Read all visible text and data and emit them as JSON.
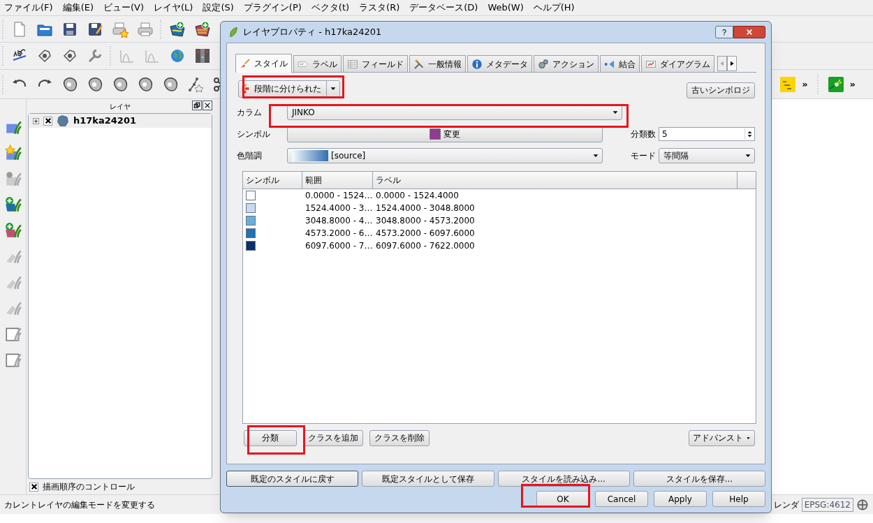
{
  "menu": [
    "ファイル(F)",
    "編集(E)",
    "ビュー(V)",
    "レイヤ(L)",
    "設定(S)",
    "プラグイン(P)",
    "ベクタ(t)",
    "ラスタ(R)",
    "データベース(D)",
    "Web(W)",
    "ヘルプ(H)"
  ],
  "layers_panel": {
    "title": "レイヤ",
    "layers": [
      {
        "name": "h17ka24201",
        "visible": true
      }
    ],
    "render_order": {
      "label": "描画順序のコントロール",
      "checked": true
    }
  },
  "toolbar_overflow": [
    "»",
    "»"
  ],
  "dialog": {
    "title": "レイヤプロパティ - h17ka24201",
    "tabs": [
      {
        "label": "スタイル",
        "selected": true
      },
      {
        "label": "ラベル",
        "selected": false
      },
      {
        "label": "フィールド",
        "selected": false
      },
      {
        "label": "一般情報",
        "selected": false
      },
      {
        "label": "メタデータ",
        "selected": false
      },
      {
        "label": "アクション",
        "selected": false
      },
      {
        "label": "結合",
        "selected": false
      },
      {
        "label": "ダイアグラム",
        "selected": false
      }
    ],
    "renderer": "段階に分けられた",
    "old_symbology_button": "古いシンボロジ",
    "column": {
      "label": "カラム",
      "value": "JINKO"
    },
    "symbol": {
      "label": "シンボル",
      "button": "変更"
    },
    "classes_count": {
      "label": "分類数",
      "value": "5"
    },
    "color_ramp": {
      "label": "色階調",
      "value": "[source]"
    },
    "mode": {
      "label": "モード",
      "value": "等間隔"
    },
    "table": {
      "columns": [
        "シンボル",
        "範囲",
        "ラベル"
      ],
      "rows": [
        {
          "color": "#f7fbff",
          "range": "0.0000 - 1524…",
          "label": "0.0000 - 1524.4000"
        },
        {
          "color": "#c6dbef",
          "range": "1524.4000 - 3…",
          "label": "1524.4000 - 3048.8000"
        },
        {
          "color": "#6baed6",
          "range": "3048.8000 - 4…",
          "label": "3048.8000 - 4573.2000"
        },
        {
          "color": "#2171b5",
          "range": "4573.2000 - 6…",
          "label": "4573.2000 - 6097.6000"
        },
        {
          "color": "#08306b",
          "range": "6097.6000 - 7…",
          "label": "6097.6000 - 7622.0000"
        }
      ]
    },
    "class_buttons": [
      "分類",
      "クラスを追加",
      "クラスを削除"
    ],
    "advanced_button": "アドバンスト",
    "style_buttons": [
      "既定のスタイルに戻す",
      "既定スタイルとして保存",
      "スタイルを読み込み...",
      "スタイルを保存..."
    ],
    "buttons": [
      "OK",
      "Cancel",
      "Apply",
      "Help"
    ]
  },
  "status_bar": {
    "message": "カレントレイヤの編集モードを変更する",
    "render_label": "レンダ",
    "crs": "EPSG:4612"
  }
}
